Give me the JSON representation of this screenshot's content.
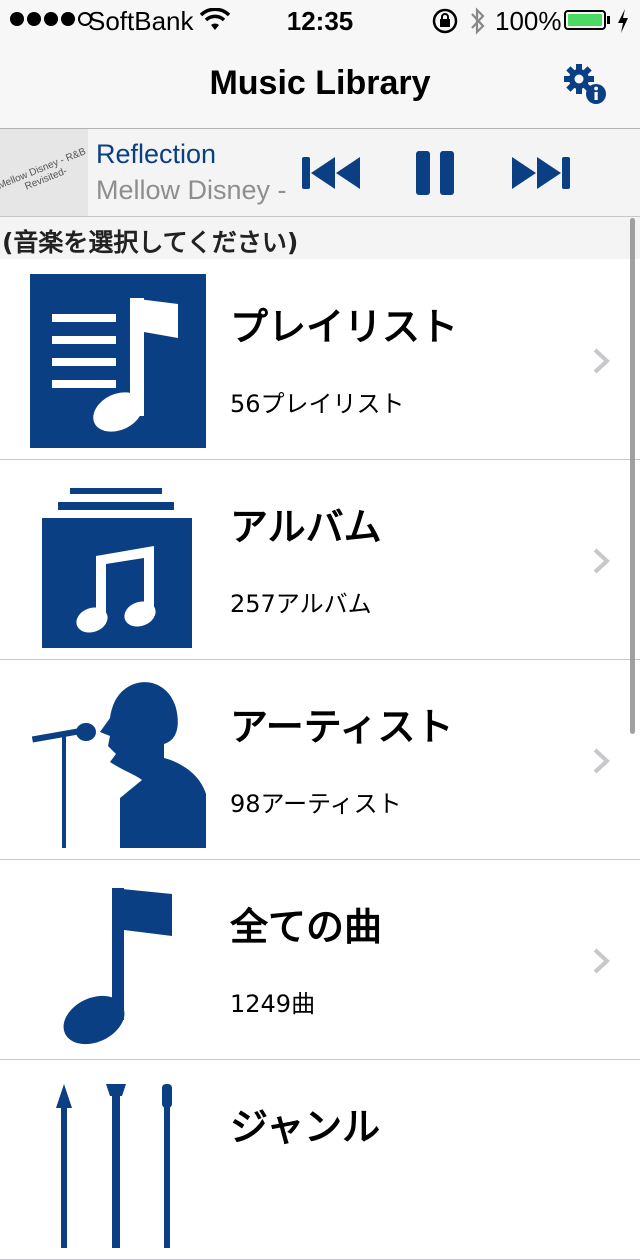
{
  "status_bar": {
    "carrier": "SoftBank",
    "time": "12:35",
    "battery_percent": "100%",
    "battery_level": 1.0,
    "signal_bars": 4,
    "signal_max": 5
  },
  "navbar": {
    "title": "Music Library",
    "settings_icon": "gear-info-icon"
  },
  "now_playing": {
    "artwork_text": "Mellow Disney - R&B Revisited-",
    "track_title": "Reflection",
    "artist": "Mellow Disney -",
    "controls": [
      "previous-track-icon",
      "pause-icon",
      "next-track-icon"
    ]
  },
  "section": {
    "header": "(音楽を選択してください)"
  },
  "categories": [
    {
      "label": "プレイリスト",
      "count": "56プレイリスト",
      "icon": "playlist-icon"
    },
    {
      "label": "アルバム",
      "count": "257アルバム",
      "icon": "album-icon"
    },
    {
      "label": "アーティスト",
      "count": "98アーティスト",
      "icon": "artist-icon"
    },
    {
      "label": "全ての曲",
      "count": "1249曲",
      "icon": "song-note-icon"
    },
    {
      "label": "ジャンル",
      "icon": "genre-icon"
    }
  ],
  "colors": {
    "accent": "#0b3f84",
    "battery": "#4cd964",
    "secondary_text": "#8e8e8e",
    "bar_background": "#f7f7f7"
  }
}
